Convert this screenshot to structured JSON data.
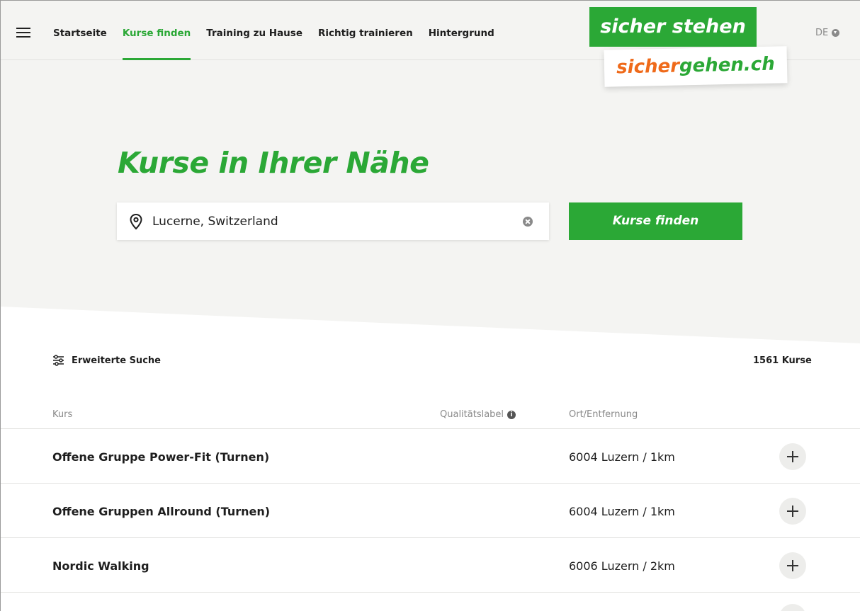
{
  "nav": {
    "items": [
      {
        "label": "Startseite"
      },
      {
        "label": "Kurse finden",
        "active": true
      },
      {
        "label": "Training zu Hause"
      },
      {
        "label": "Richtig trainieren"
      },
      {
        "label": "Hintergrund"
      }
    ],
    "language": "DE"
  },
  "logo": {
    "top": "sicher stehen",
    "bottom_part1": "sicher",
    "bottom_part2": "gehen.ch"
  },
  "hero": {
    "title": "Kurse in Ihrer Nähe",
    "search_value": "Lucerne, Switzerland",
    "search_button": "Kurse finden"
  },
  "results": {
    "advanced_search": "Erweiterte Suche",
    "count": "1561 Kurse",
    "columns": {
      "course": "Kurs",
      "quality": "Qualitätslabel",
      "place": "Ort/Entfernung"
    },
    "rows": [
      {
        "title": "Offene Gruppe Power-Fit (Turnen)",
        "place": "6004 Luzern / 1km"
      },
      {
        "title": "Offene Gruppen Allround (Turnen)",
        "place": "6004 Luzern / 1km"
      },
      {
        "title": "Nordic Walking",
        "place": "6006 Luzern / 2km"
      }
    ]
  },
  "colors": {
    "brand_green": "#2ba836",
    "brand_orange": "#ef6a1a",
    "hero_background": "#f4f4f2"
  }
}
